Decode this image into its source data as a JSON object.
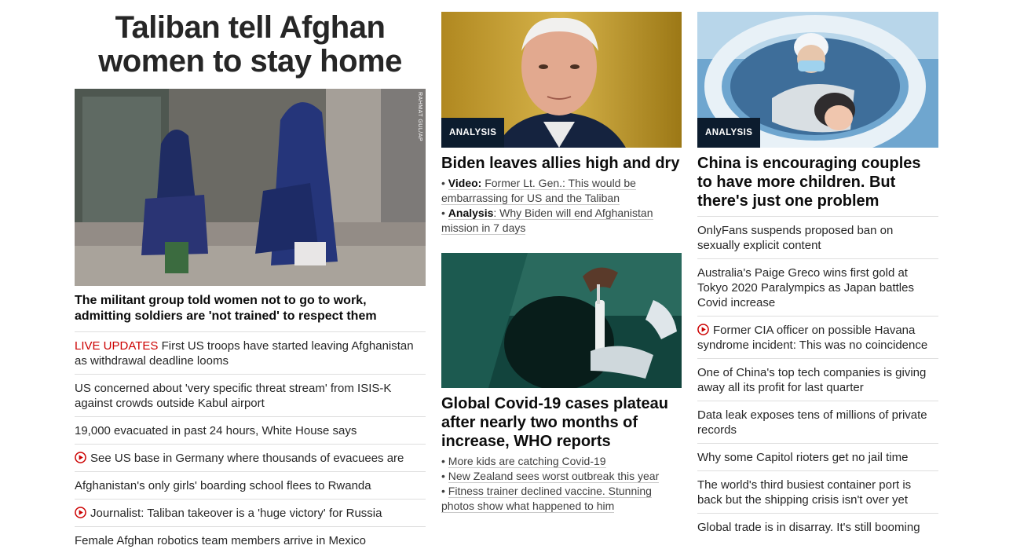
{
  "col1": {
    "banner_headline": "Taliban tell Afghan women to stay home",
    "image_credit": "RAHMAT GUL/AP",
    "lead_title": "The militant group told women not to go to work, admitting soldiers are 'not trained' to respect them",
    "items": [
      {
        "prefix": "LIVE UPDATES",
        "text": " First US troops have started leaving Afghanistan as withdrawal deadline looms"
      },
      {
        "text": "US concerned about 'very specific threat stream' from ISIS-K against crowds outside Kabul airport"
      },
      {
        "text": "19,000 evacuated in past 24 hours, White House says"
      },
      {
        "video": true,
        "text": "See US base in Germany where thousands of evacuees are"
      },
      {
        "text": "Afghanistan's only girls' boarding school flees to Rwanda"
      },
      {
        "video": true,
        "text": "Journalist: Taliban takeover is a 'huge victory' for Russia"
      },
      {
        "text": "Female Afghan robotics team members arrive in Mexico"
      }
    ]
  },
  "col2": {
    "story1": {
      "badge": "ANALYSIS",
      "title": "Biden leaves allies high and dry",
      "sub": [
        {
          "bold": "Video:",
          "text": " Former Lt. Gen.: This would be embarrassing for US and the Taliban"
        },
        {
          "bold": "Analysis",
          "text": ": Why Biden will end Afghanistan mission in 7 days"
        }
      ]
    },
    "story2": {
      "title": "Global Covid-19 cases plateau after nearly two months of increase, WHO reports",
      "sub": [
        {
          "text": "More kids are catching Covid-19"
        },
        {
          "text": "New Zealand sees worst outbreak this year"
        },
        {
          "text": "Fitness trainer declined vaccine. Stunning photos show what happened to him"
        }
      ]
    }
  },
  "col3": {
    "badge": "ANALYSIS",
    "lead_title": "China is encouraging couples to have more children. But there's just one problem",
    "items": [
      {
        "text": "OnlyFans suspends proposed ban on sexually explicit content"
      },
      {
        "text": "Australia's Paige Greco wins first gold at Tokyo 2020 Paralympics as Japan battles Covid increase"
      },
      {
        "video": true,
        "text": "Former CIA officer on possible Havana syndrome incident: This was no coincidence"
      },
      {
        "text": "One of China's top tech companies is giving away all its profit for last quarter"
      },
      {
        "text": "Data leak exposes tens of millions of private records"
      },
      {
        "text": "Why some Capitol rioters get no jail time"
      },
      {
        "text": "The world's third busiest container port is back but the shipping crisis isn't over yet"
      },
      {
        "text": "Global trade is in disarray. It's still booming"
      }
    ]
  },
  "colors": {
    "live_red": "#cc0000",
    "badge_bg": "#0c1c2e",
    "divider": "#dedede"
  }
}
